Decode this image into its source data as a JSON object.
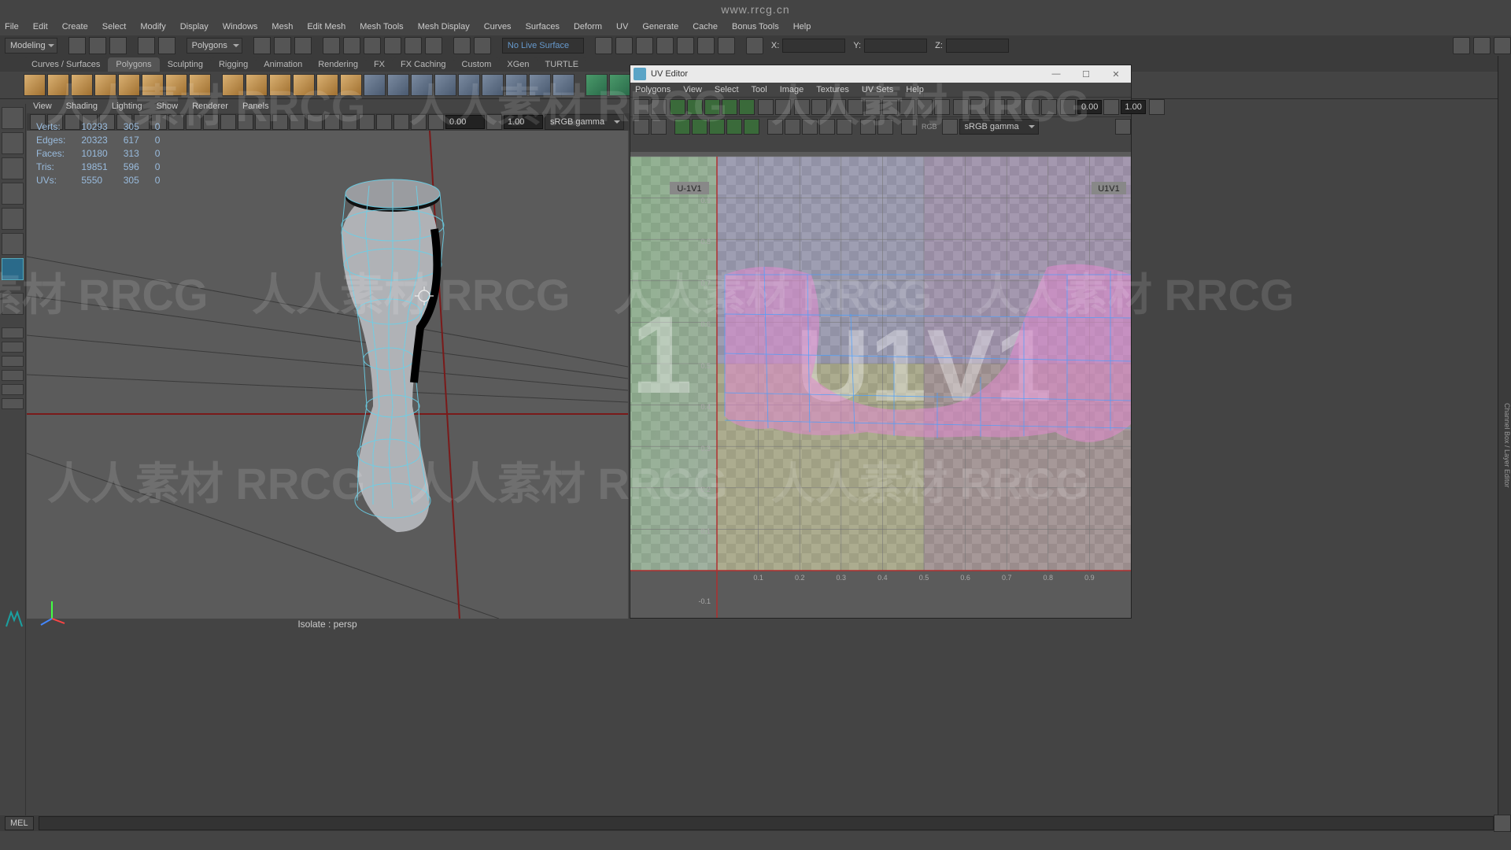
{
  "watermark_url": "www.rrcg.cn",
  "watermark_text": "人人素材  RRCG",
  "topmenu": [
    "File",
    "Edit",
    "Create",
    "Select",
    "Modify",
    "Display",
    "Windows",
    "Mesh",
    "Edit Mesh",
    "Mesh Tools",
    "Mesh Display",
    "Curves",
    "Surfaces",
    "Deform",
    "UV",
    "Generate",
    "Cache",
    "Bonus Tools",
    "Help"
  ],
  "mode_selector": "Modeling",
  "quick_items_selector": "Polygons",
  "statusfields": {
    "sym_off": "",
    "no_live": "No Live Surface"
  },
  "coord": {
    "x_label": "X:",
    "y_label": "Y:",
    "z_label": "Z:",
    "x": "",
    "y": "",
    "z": ""
  },
  "shelf_tabs": [
    "Curves / Surfaces",
    "Polygons",
    "Sculpting",
    "Rigging",
    "Animation",
    "Rendering",
    "FX",
    "FX Caching",
    "Custom",
    "XGen",
    "TURTLE"
  ],
  "shelf_active": "Polygons",
  "panel_menu": [
    "View",
    "Shading",
    "Lighting",
    "Show",
    "Renderer",
    "Panels"
  ],
  "panel_toolbar": {
    "num_a": "0.00",
    "num_b": "1.00",
    "gamma": "sRGB gamma"
  },
  "hud": {
    "headers": [
      "",
      "",
      "",
      ""
    ],
    "rows": [
      {
        "label": "Verts:",
        "c1": "10293",
        "c2": "305",
        "c3": "0"
      },
      {
        "label": "Edges:",
        "c1": "20323",
        "c2": "617",
        "c3": "0"
      },
      {
        "label": "Faces:",
        "c1": "10180",
        "c2": "313",
        "c3": "0"
      },
      {
        "label": "Tris:",
        "c1": "19851",
        "c2": "596",
        "c3": "0"
      },
      {
        "label": "UVs:",
        "c1": "5550",
        "c2": "305",
        "c3": "0"
      }
    ]
  },
  "viewport_footer": "Isolate : persp",
  "uvwin": {
    "title": "UV Editor",
    "menu": [
      "Polygons",
      "View",
      "Select",
      "Tool",
      "Image",
      "Textures",
      "UV Sets",
      "Help"
    ],
    "toolbar": {
      "num_a": "0.00",
      "num_b": "1.00",
      "gamma": "sRGB gamma",
      "rgb_label": "RGB"
    },
    "tiles": {
      "left": "U-1V1",
      "right": "U1V1",
      "big_left": "1",
      "big_center": "U1V1"
    },
    "axis_ticks": [
      "0.1",
      "0.2",
      "0.3",
      "0.4",
      "0.5",
      "0.6",
      "0.7",
      "0.8",
      "0.9"
    ]
  },
  "cmdline": {
    "lang": "MEL",
    "input": ""
  },
  "right_sidebar_labels": [
    "Channel Box / Layer Editor"
  ],
  "icons": {
    "window_min": "—",
    "window_max": "☐",
    "window_close": "✕"
  }
}
